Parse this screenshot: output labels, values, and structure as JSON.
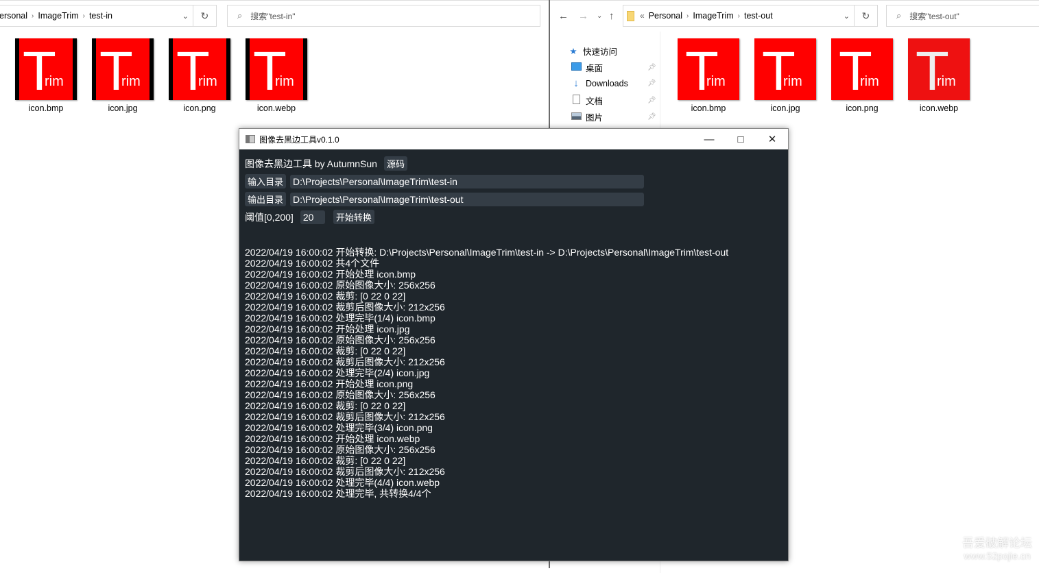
{
  "left_explorer": {
    "breadcrumb": [
      "ersonal",
      "ImageTrim",
      "test-in"
    ],
    "search_placeholder": "搜索\"test-in\"",
    "files": [
      "icon.bmp",
      "icon.jpg",
      "icon.png",
      "icon.webp"
    ]
  },
  "right_explorer": {
    "breadcrumb": [
      "Personal",
      "ImageTrim",
      "test-out"
    ],
    "search_placeholder": "搜索\"test-out\"",
    "sidebar": [
      {
        "label": "快速访问",
        "icon": "star-icon"
      },
      {
        "label": "桌面",
        "icon": "desktop-icon"
      },
      {
        "label": "Downloads",
        "icon": "download-icon"
      },
      {
        "label": "文档",
        "icon": "document-icon"
      },
      {
        "label": "图片",
        "icon": "pictures-icon"
      }
    ],
    "files": [
      "icon.bmp",
      "icon.jpg",
      "icon.png",
      "icon.webp"
    ]
  },
  "thumbnail_text": {
    "big": "T",
    "small": "rim"
  },
  "app": {
    "title": "图像去黑边工具v0.1.0",
    "heading": "图像去黑边工具 by AutumnSun",
    "source_button": "源码",
    "input_dir_button": "输入目录",
    "input_dir": "D:\\Projects\\Personal\\ImageTrim\\test-in",
    "output_dir_button": "输出目录",
    "output_dir": "D:\\Projects\\Personal\\ImageTrim\\test-out",
    "threshold_label": "阈值[0,200]",
    "threshold_value": "20",
    "start_button": "开始转换",
    "log": [
      "2022/04/19 16:00:02 开始转换: D:\\Projects\\Personal\\ImageTrim\\test-in -> D:\\Projects\\Personal\\ImageTrim\\test-out",
      "2022/04/19 16:00:02 共4个文件",
      "2022/04/19 16:00:02 开始处理 icon.bmp",
      "2022/04/19 16:00:02 原始图像大小: 256x256",
      "2022/04/19 16:00:02 裁剪: [0 22 0 22]",
      "2022/04/19 16:00:02 裁剪后图像大小: 212x256",
      "2022/04/19 16:00:02 处理完毕(1/4) icon.bmp",
      "2022/04/19 16:00:02 开始处理 icon.jpg",
      "2022/04/19 16:00:02 原始图像大小: 256x256",
      "2022/04/19 16:00:02 裁剪: [0 22 0 22]",
      "2022/04/19 16:00:02 裁剪后图像大小: 212x256",
      "2022/04/19 16:00:02 处理完毕(2/4) icon.jpg",
      "2022/04/19 16:00:02 开始处理 icon.png",
      "2022/04/19 16:00:02 原始图像大小: 256x256",
      "2022/04/19 16:00:02 裁剪: [0 22 0 22]",
      "2022/04/19 16:00:02 裁剪后图像大小: 212x256",
      "2022/04/19 16:00:02 处理完毕(3/4) icon.png",
      "2022/04/19 16:00:02 开始处理 icon.webp",
      "2022/04/19 16:00:02 原始图像大小: 256x256",
      "2022/04/19 16:00:02 裁剪: [0 22 0 22]",
      "2022/04/19 16:00:02 裁剪后图像大小: 212x256",
      "2022/04/19 16:00:02 处理完毕(4/4) icon.webp",
      "2022/04/19 16:00:02 处理完毕, 共转换4/4个"
    ]
  },
  "watermark": {
    "line1": "吾爱破解论坛",
    "line2": "www.52pojie.cn"
  }
}
